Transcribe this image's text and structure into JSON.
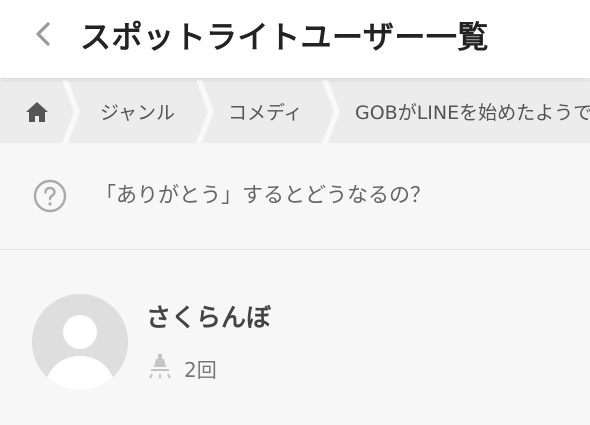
{
  "header": {
    "title": "スポットライトユーザー一覧",
    "back_icon": "chevron-left-icon"
  },
  "breadcrumb": {
    "home_icon": "home-icon",
    "items": [
      {
        "label": "ジャンル"
      },
      {
        "label": "コメディ"
      },
      {
        "label": "GOBがLINEを始めたようです"
      }
    ]
  },
  "help": {
    "icon": "question-circle-icon",
    "text": "「ありがとう」するとどうなるの？"
  },
  "users": [
    {
      "name": "さくらんぼ",
      "avatar_icon": "default-avatar-icon",
      "count_icon": "spotlight-icon",
      "count": "2回"
    }
  ],
  "colors": {
    "background": "#f7f7f7",
    "header_bg": "#ffffff",
    "breadcrumb_bg": "#ececec",
    "title_text": "#222222",
    "muted_icon": "#c4c4c4"
  }
}
